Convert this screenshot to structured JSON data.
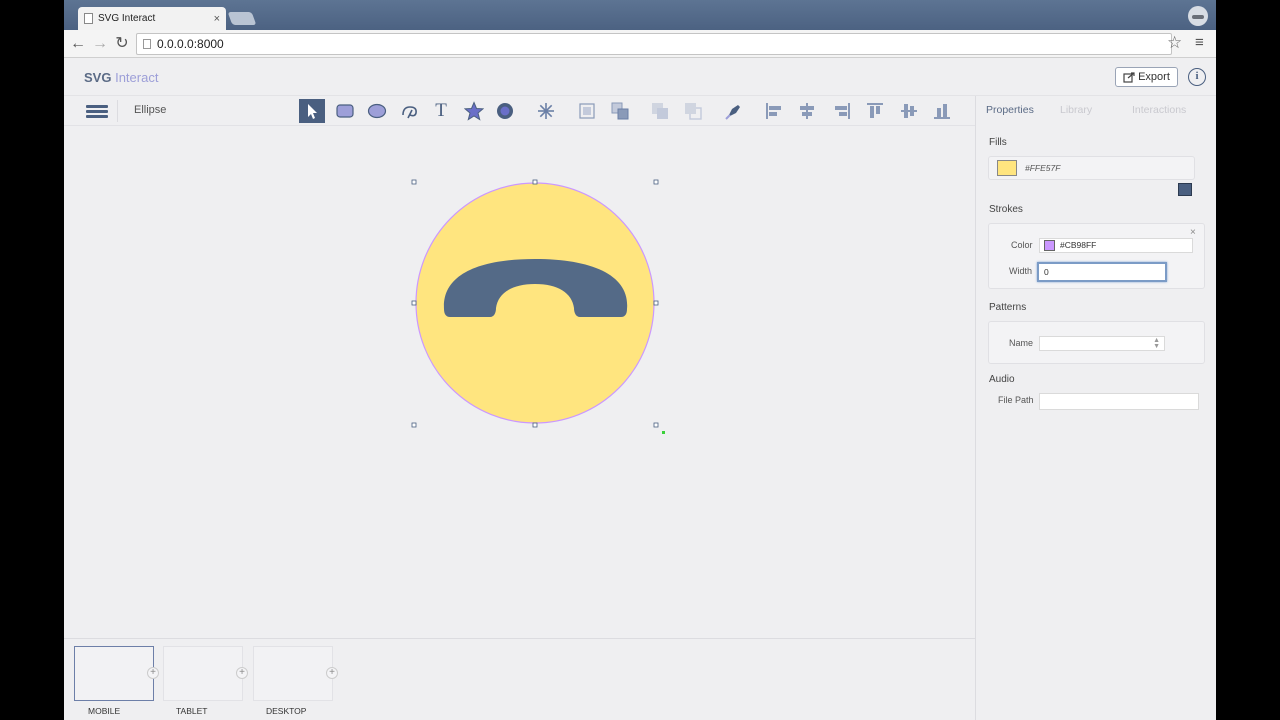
{
  "browser": {
    "tab_title": "SVG Interact",
    "tab_close": "×",
    "url": "0.0.0.0:8000",
    "back": "←",
    "forward": "→",
    "reload": "↻",
    "star": "☆",
    "menu": "≡"
  },
  "app": {
    "logo_bold": "SVG",
    "logo_light": "Interact",
    "export_label": "Export",
    "info_label": "i"
  },
  "toolbar": {
    "breadcrumb": "Ellipse",
    "tools": [
      "pointer-tool",
      "rectangle-tool",
      "ellipse-tool",
      "path-tool",
      "text-tool",
      "star-tool",
      "image-tool",
      "burst-tool",
      "group-tool",
      "ungroup-tool",
      "bring-forward-tool",
      "send-backward-tool",
      "pen-tool",
      "align-left-tool",
      "align-center-tool",
      "align-right-tool",
      "align-top-tool",
      "align-middle-tool",
      "align-bottom-tool"
    ],
    "text_tool_label": "T"
  },
  "colors": {
    "fill": "#FFE57F",
    "stroke": "#CB98FF",
    "accent": "#4A5F80"
  },
  "panel": {
    "tabs": [
      "Properties",
      "Library",
      "Interactions"
    ],
    "fills_title": "Fills",
    "fill_hex": "#FFE57F",
    "strokes_title": "Strokes",
    "color_label": "Color",
    "stroke_hex": "#CB98FF",
    "width_label": "Width",
    "width_value": "0",
    "patterns_title": "Patterns",
    "name_label": "Name",
    "name_value": "",
    "audio_title": "Audio",
    "file_path_label": "File Path",
    "file_path_value": "",
    "close": "×"
  },
  "devices": [
    {
      "label": "MOBILE",
      "plus": "+"
    },
    {
      "label": "TABLET",
      "plus": "+"
    },
    {
      "label": "DESKTOP",
      "plus": "+"
    }
  ]
}
